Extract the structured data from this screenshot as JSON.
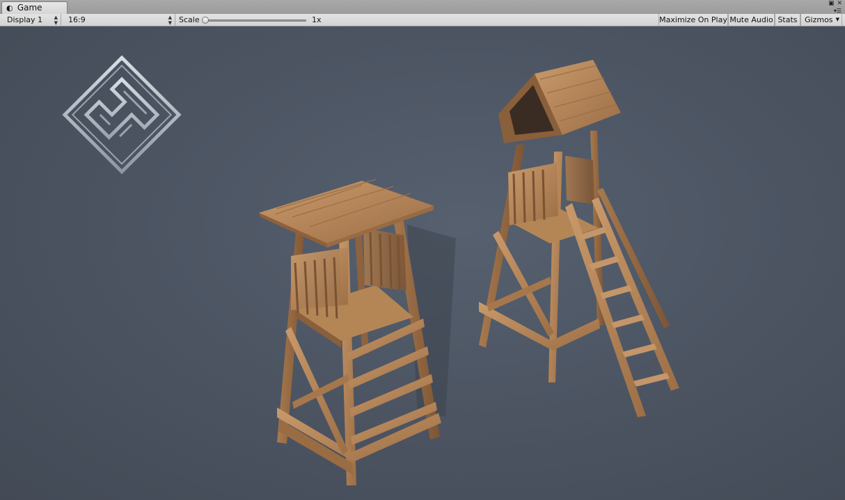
{
  "window": {
    "tab_label": "Game",
    "tab_icon": "game-controller-icon",
    "controls": [
      "maximize-icon",
      "close-icon",
      "panel-menu-icon"
    ]
  },
  "toolbar": {
    "display_select": "Display 1",
    "aspect_select": "16:9",
    "scale_label": "Scale",
    "scale_value": "1x",
    "scale_slider_fraction": 0.0,
    "maximize_on_play": "Maximize On Play",
    "mute_audio": "Mute Audio",
    "stats": "Stats",
    "gizmos": "Gizmos"
  },
  "viewport": {
    "background_color": "#4d5563",
    "logo": "diamond-maze-logo",
    "objects": [
      "watchtower-flat-roof",
      "watchtower-pitched-roof-with-stairs"
    ],
    "wood_color": "#b8875a"
  }
}
